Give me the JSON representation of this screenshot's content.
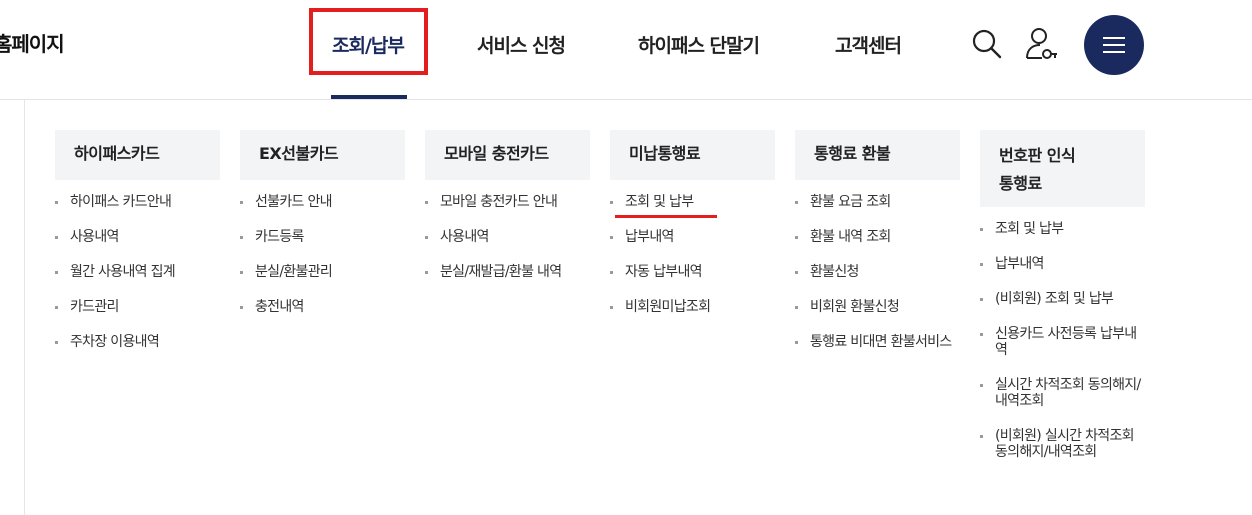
{
  "header": {
    "home_title": "홈페이지",
    "nav": [
      {
        "label": "조회/납부",
        "active": true
      },
      {
        "label": "서비스 신청",
        "active": false
      },
      {
        "label": "하이패스 단말기",
        "active": false
      },
      {
        "label": "고객센터",
        "active": false
      }
    ],
    "icons": [
      "search-icon",
      "user-icon",
      "hamburger-menu-icon"
    ],
    "colors": {
      "brand": "#1b2a5e",
      "highlight": "#e41e1e"
    }
  },
  "menu": {
    "columns": [
      {
        "title": "하이패스카드",
        "items": [
          "하이패스 카드안내",
          "사용내역",
          "월간 사용내역 집계",
          "카드관리",
          "주차장 이용내역"
        ]
      },
      {
        "title": "EX선불카드",
        "items": [
          "선불카드 안내",
          "카드등록",
          "분실/환불관리",
          "충전내역"
        ]
      },
      {
        "title": "모바일 충전카드",
        "items": [
          "모바일 충전카드 안내",
          "사용내역",
          "분실/재발급/환불 내역"
        ]
      },
      {
        "title": "미납통행료",
        "items": [
          "조회 및 납부",
          "납부내역",
          "자동 납부내역",
          "비회원미납조회"
        ]
      },
      {
        "title": "통행료 환불",
        "items": [
          "환불 요금 조회",
          "환불 내역 조회",
          "환불신청",
          "비회원 환불신청",
          "통행료 비대면 환불서비스"
        ]
      },
      {
        "title_line1": "번호판 인식",
        "title_line2": "통행료",
        "items": [
          "조회 및 납부",
          "납부내역",
          "(비회원) 조회 및 납부",
          "신용카드 사전등록 납부내역",
          "실시간 차적조회 동의해지/내역조회",
          "(비회원) 실시간 차적조회 동의해지/내역조회"
        ]
      }
    ]
  }
}
